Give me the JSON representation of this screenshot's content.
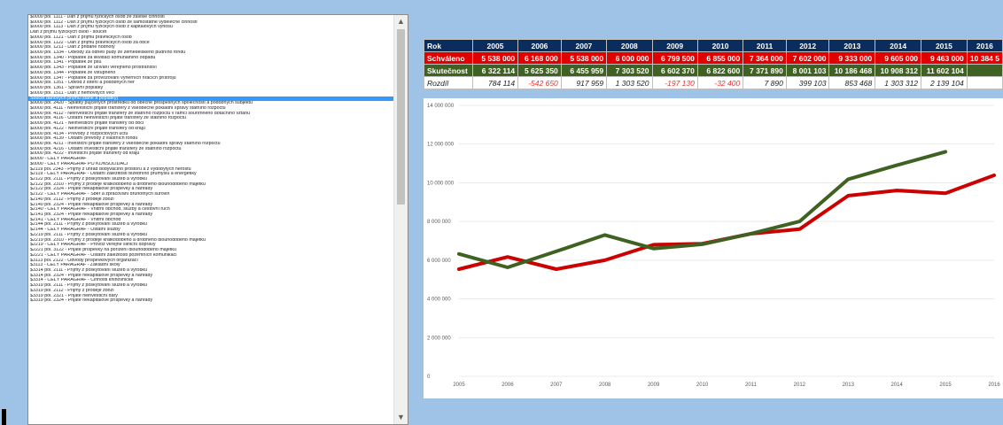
{
  "list": {
    "selected_index": 27,
    "items": [
      "$0000 pol. 1111 - Daň z příjmů fyzických osob ze závislé činnosti",
      "$0000 pol. 1112 - Daň z příjmů fyzických osob ze samostatné výdělečné činnosti",
      "$0000 pol. 1113 - Daň z příjmů fyzických osob z kapitálových výnosů",
      "Daň z příjmů fyzických osob - součet",
      "$0000 pol. 1121 - Daň z příjmů právnických osob",
      "$0000 pol. 1122 - Daň z příjmů právnických osob za obce",
      "$0000 pol. 1211 - Daň z přidané hodnoty",
      "$0000 pol. 1334 - Odvody za odnětí půdy ze zemědělského půdního fondu",
      "$0000 pol. 1340 - Poplatek za likvidaci komunálního odpadu",
      "$0000 pol. 1341 - Poplatek ze psů",
      "$0000 pol. 1343 - Poplatek ze užívání veřejného prostranství",
      "$0000 pol. 1344 - Poplatek ze vstupného",
      "$0000 pol. 1347 - Poplatek za provozování výherních hracích přístrojů",
      "$0000 pol. 1351 - Odvod z loterií a podobných her",
      "$0000 pol. 1361 - Správní poplatky",
      "$0000 pol. 1511 - Daň z nemovitých věcí",
      "Součet daňových příjmů (daně a poplatky)",
      "$0000 pol. 2420 - Splátky půjčených prostředků od obecně prospěšných společností a podobných subjektů",
      "$0000 pol. 4111 - Neinvestiční přijaté transfery z všeobecné pokladní správy státního rozpočtu",
      "$0000 pol. 4112 - Neinvestiční přijaté transfery ze státního rozpočtu v rámci souhrnného dotačního vztahu",
      "$0000 pol. 4116 - Ostatní neinvestiční přijaté transfery ze státního rozpočtu",
      "$0000 pol. 4121 - Neinvestiční přijaté transfery od obcí",
      "$0000 pol. 4122 - Neinvestiční přijaté transfery od krajů",
      "$0000 pol. 4134 - Převody z rozpočtových účtů",
      "$0000 pol. 4139 - Ostatní převody z vlastních fondů",
      "$0000 pol. 4211 - Investiční přijaté transfery z všeobecné pokladní správy státního rozpočtu",
      "$0000 pol. 4216 - Ostatní investiční přijaté transfery ze státního rozpočtu",
      "$0000 pol. 4222 - Investiční přijaté transfery od krajů",
      "$0000 - CELÝ PARAGRAF",
      "$0000 - CELÝ PARAGRAF PO KONSOLIDACI",
      "$2119 pol. 2343 - Příjmy z úhrad dobývacího prostoru a z vydobytých nerostů",
      "$2119 - CELÝ PARAGRAF - Ostatní záležitosti těžebního průmyslu a energetiky",
      "$2122 pol. 2111 - Příjmy z poskytování služeb a výrobků",
      "$2122 pol. 2310 - Příjmy z prodeje krátkodobého a drobného dlouhodobého majetku",
      "$2122 pol. 2324 - Přijaté nekapitálové příspěvky a náhrady",
      "$2122 - CELÝ PARAGRAF - Sběr a zpracování druhotných surovin",
      "$2140 pol. 2112 - Příjmy z prodeje zboží",
      "$2140 pol. 2324 - Přijaté nekapitálové příspěvky a náhrady",
      "$2140 - CELÝ PARAGRAF - Vnitřní obchod, služby a cestovní ruch",
      "$2141 pol. 2324 - Přijaté nekapitálové příspěvky a náhrady",
      "$2141 - CELÝ PARAGRAF - Vnitřní obchod",
      "$2144 pol. 2111 - Příjmy z poskytování služeb a výrobků",
      "$2144 - CELÝ PARAGRAF - Ostatní služby",
      "$2219 pol. 2111 - Příjmy z poskytování služeb a výrobků",
      "$2219 pol. 2310 - Příjmy z prodeje krátkodobého a drobného dlouhodobého majetku",
      "$2219 - CELÝ PARAGRAF - Provoz veřejné silniční dopravy",
      "$2221 pol. 3122 - Přijaté příspěvky na pořízení dlouhodobého majetku",
      "$2221 - CELÝ PARAGRAF - Ostatní záležitosti pozemních komunikací",
      "$3113 pol. 2122 - Odvody příspěvkových organizací",
      "$3113 - CELÝ PARAGRAF - Základní školy",
      "$3314 pol. 2111 - Příjmy z poskytování služeb a výrobků",
      "$3314 pol. 2324 - Přijaté nekapitálové příspěvky a náhrady",
      "$3314 - CELÝ PARAGRAF - Činnosti knihovnické",
      "$3319 pol. 2111 - Příjmy z poskytování služeb a výrobků",
      "$3319 pol. 2112 - Příjmy z prodeje zboží",
      "$3319 pol. 2321 - Přijaté neinvestiční dary",
      "$3319 pol. 2324 - Přijaté nekapitálové příspěvky a náhrady"
    ]
  },
  "table": {
    "header_label": "Rok",
    "years": [
      "2005",
      "2006",
      "2007",
      "2008",
      "2009",
      "2010",
      "2011",
      "2012",
      "2013",
      "2014",
      "2015",
      "2016"
    ],
    "rows": [
      {
        "label": "Schváleno",
        "cells": [
          "5 538 000",
          "6 168 000",
          "5 538 000",
          "6 000 000",
          "6 799 500",
          "6 855 000",
          "7 364 000",
          "7 602 000",
          "9 333 000",
          "9 605 000",
          "9 463 000",
          "10 384 5"
        ]
      },
      {
        "label": "Skutečnost",
        "cells": [
          "6 322 114",
          "5 625 350",
          "6 455 959",
          "7 303 520",
          "6 602 370",
          "6 822 600",
          "7 371 890",
          "8 001 103",
          "10 186 468",
          "10 908 312",
          "11 602 104",
          ""
        ]
      },
      {
        "label": "Rozdíl",
        "cells": [
          "784 114",
          "-542 650",
          "917 959",
          "1 303 520",
          "-197 130",
          "-32 400",
          "7 890",
          "399 103",
          "853 468",
          "1 303 312",
          "2 139 104",
          ""
        ]
      }
    ]
  },
  "chart_data": {
    "type": "line",
    "x": [
      "2005",
      "2006",
      "2007",
      "2008",
      "2009",
      "2010",
      "2011",
      "2012",
      "2013",
      "2014",
      "2015",
      "2016"
    ],
    "ylim": [
      0,
      14000000
    ],
    "yticks": [
      "0",
      "2 000 000",
      "4 000 000",
      "6 000 000",
      "8 000 000",
      "10 000 000",
      "12 000 000",
      "14 000 000"
    ],
    "series": [
      {
        "color": "#cc0000",
        "values": [
          5538000,
          6168000,
          5538000,
          6000000,
          6799500,
          6855000,
          7364000,
          7602000,
          9333000,
          9605000,
          9463000,
          10384500
        ]
      },
      {
        "color": "#3f6121",
        "values": [
          6322114,
          5625350,
          6455959,
          7303520,
          6602370,
          6822600,
          7371890,
          8001103,
          10186468,
          10908312,
          11602104,
          null
        ]
      }
    ]
  }
}
